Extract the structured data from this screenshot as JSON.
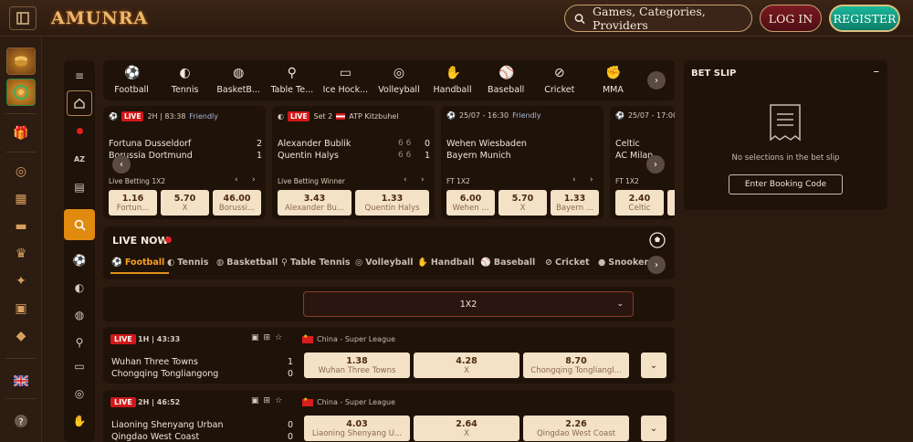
{
  "header": {
    "logo": "AMUNRA",
    "search_placeholder": "Games, Categories, Providers",
    "login_label": "LOG IN",
    "register_label": "REGISTER"
  },
  "sports_tabs": [
    "Football",
    "Tennis",
    "BasketB...",
    "Table Te...",
    "Ice Hock...",
    "Volleyball",
    "Handball",
    "Baseball",
    "Cricket",
    "MMA"
  ],
  "snav_az": "AZ",
  "cards": [
    {
      "live": "LIVE",
      "clock": "2H | 83:38",
      "league": "Friendly",
      "home": "Fortuna Dusseldorf",
      "away": "Borussia Dortmund",
      "home_score": "2",
      "away_score": "1",
      "market": "Live Betting 1X2",
      "odds": [
        {
          "v": "1.16",
          "n": "Fortun..."
        },
        {
          "v": "5.70",
          "n": "X"
        },
        {
          "v": "46.00",
          "n": "Borussi..."
        }
      ]
    },
    {
      "live": "LIVE",
      "clock": "Set 2",
      "league": "ATP Kitzbuhel",
      "home": "Alexander Bublik",
      "away": "Quentin Halys",
      "home_sets": "6  6",
      "away_sets": "6  6",
      "home_score": "0",
      "away_score": "1",
      "market": "Live Betting Winner",
      "odds": [
        {
          "v": "3.43",
          "n": "Alexander Bu..."
        },
        {
          "v": "1.33",
          "n": "Quentin Halys"
        }
      ]
    },
    {
      "clock": "25/07 - 16:30",
      "league": "Friendly",
      "home": "Wehen Wiesbaden",
      "away": "Bayern Munich",
      "market": "FT 1X2",
      "odds": [
        {
          "v": "6.00",
          "n": "Wehen ..."
        },
        {
          "v": "5.70",
          "n": "X"
        },
        {
          "v": "1.33",
          "n": "Bayern ..."
        }
      ]
    },
    {
      "clock": "25/07 - 17:00",
      "home": "Celtic",
      "away": "AC Milan",
      "market": "FT 1X2",
      "odds": [
        {
          "v": "2.40",
          "n": "Celtic"
        }
      ]
    }
  ],
  "live_now": {
    "title": "LIVE NOW",
    "tabs": [
      "Football",
      "Tennis",
      "Basketball",
      "Table Tennis",
      "Volleyball",
      "Handball",
      "Baseball",
      "Cricket",
      "Snooker &"
    ]
  },
  "market_select": "1X2",
  "events": [
    {
      "live": "LIVE",
      "time": "1H | 43:33",
      "league": "China - Super League",
      "home": "Wuhan Three Towns",
      "away": "Chongqing Tongliangong",
      "home_score": "1",
      "away_score": "0",
      "odds": [
        {
          "v": "1.38",
          "n": "Wuhan Three Towns"
        },
        {
          "v": "4.28",
          "n": "X"
        },
        {
          "v": "8.70",
          "n": "Chongqing Tongliangl..."
        }
      ]
    },
    {
      "live": "LIVE",
      "time": "2H | 46:52",
      "league": "China - Super League",
      "home": "Liaoning Shenyang Urban",
      "away": "Qingdao West Coast",
      "home_score": "0",
      "away_score": "0",
      "odds": [
        {
          "v": "4.03",
          "n": "Liaoning Shenyang U..."
        },
        {
          "v": "2.64",
          "n": "X"
        },
        {
          "v": "2.26",
          "n": "Qingdao West Coast"
        }
      ]
    }
  ],
  "betslip": {
    "title": "BET SLIP",
    "minimize": "–",
    "empty_text": "No selections in the bet slip",
    "booking_label": "Enter Booking Code"
  },
  "colors": {
    "accent": "#e08a10",
    "live": "#d01818",
    "odd_bg": "#f4e2c6",
    "register": "#1ab79a"
  }
}
